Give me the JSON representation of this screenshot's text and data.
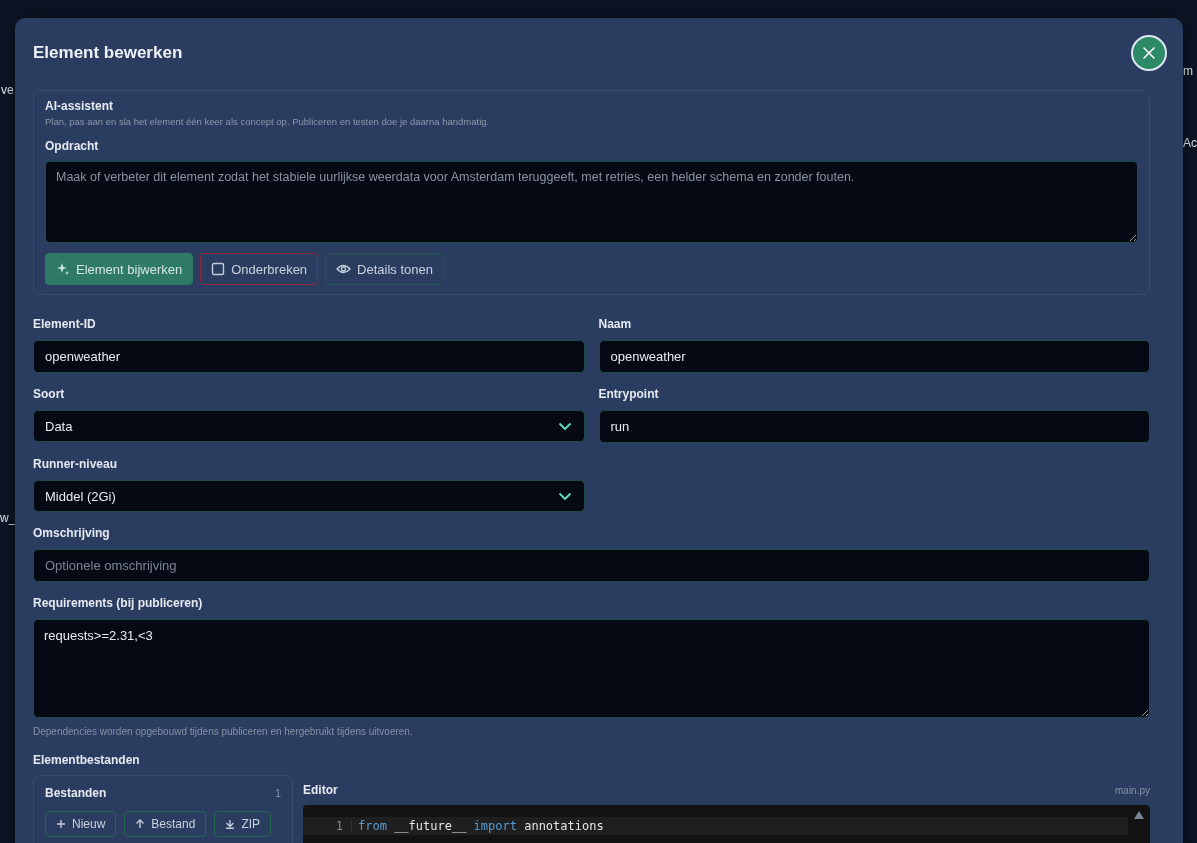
{
  "background": {
    "left_fragments": [
      "ve",
      "w_"
    ],
    "right_fragments": [
      "m",
      "Ac"
    ]
  },
  "dialog": {
    "title": "Element bewerken",
    "ai_assistant": {
      "title": "AI-assistent",
      "subtitle": "Plan, pas aan en sla het element één keer als concept op. Publiceren en testen doe je daarna handmatig.",
      "prompt_label": "Opdracht",
      "prompt_placeholder": "Maak of verbeter dit element zodat het stabiele uurlijkse weerdata voor Amsterdam teruggeeft, met retries, een helder schema en zonder fouten.",
      "buttons": [
        {
          "label": "Element bijwerken",
          "kind": "primary"
        },
        {
          "label": "Onderbreken",
          "kind": "danger"
        },
        {
          "label": "Details tonen",
          "kind": "outline"
        }
      ]
    },
    "fields": [
      {
        "label": "Element-ID",
        "kind": "text",
        "value": "openweather",
        "wide": false
      },
      {
        "label": "Naam",
        "kind": "text",
        "value": "openweather",
        "wide": false
      },
      {
        "label": "Soort",
        "kind": "select",
        "value": "Data",
        "wide": false
      },
      {
        "label": "Entrypoint",
        "kind": "text",
        "value": "run",
        "wide": false
      },
      {
        "label": "Runner-niveau",
        "kind": "select",
        "value": "Middel (2Gi)",
        "wide": false
      },
      {
        "label": "Omschrijving",
        "kind": "text",
        "placeholder": "Optionele omschrijving",
        "wide": true
      },
      {
        "label": "Requirements (bij publiceren)",
        "kind": "textarea",
        "value": "requests>=2.31,<3",
        "hint": "Dependencies worden opgebouwd tijdens publiceren en hergebruikt tijdens uitvoeren.",
        "wide": true
      }
    ],
    "files": {
      "title": "Elementbestanden",
      "panel_title": "Bestanden",
      "count": "1",
      "buttons": [
        "Nieuw",
        "Bestand",
        "ZIP"
      ]
    },
    "editor": {
      "label": "Editor",
      "filename": "main.py",
      "lines": [
        {
          "number": "1",
          "tokens": [
            {
              "text": "from",
              "kind": "keyword"
            },
            {
              "text": " __future__ ",
              "kind": "plain"
            },
            {
              "text": "import",
              "kind": "keyword"
            },
            {
              "text": " annotations",
              "kind": "plain"
            }
          ]
        }
      ]
    }
  }
}
